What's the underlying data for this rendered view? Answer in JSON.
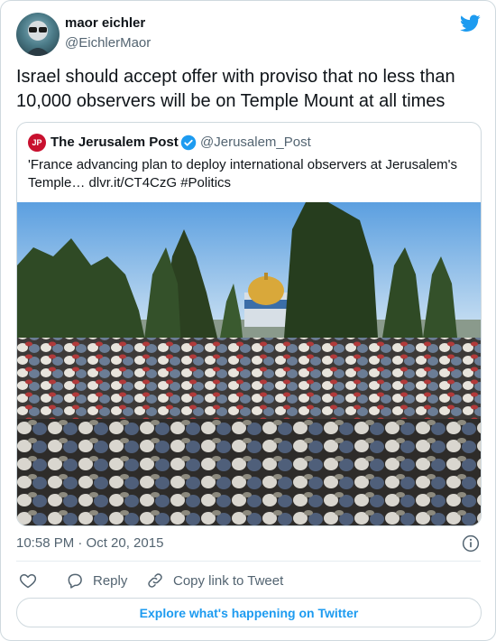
{
  "author": {
    "name": "maor eichler",
    "handle": "@EichlerMaor"
  },
  "tweet": {
    "text": "Israel should accept offer with proviso that no less than 10,000 observers will be on Temple Mount at all times"
  },
  "quoted": {
    "avatar_text": "JP",
    "name": "The Jerusalem Post",
    "handle": "@Jerusalem_Post",
    "text": "'France advancing plan to deploy international observers at Jerusalem's Temple… dlvr.it/CT4CzG #Politics"
  },
  "meta": {
    "timestamp": "10:58 PM · Oct 20, 2015"
  },
  "actions": {
    "reply": "Reply",
    "copy_link": "Copy link to Tweet"
  },
  "explore": {
    "label": "Explore what's happening on Twitter"
  },
  "colors": {
    "accent": "#1d9bf0",
    "muted": "#536471",
    "border": "#cfd9de"
  },
  "icons": [
    "twitter-bird-icon",
    "verified-badge-icon",
    "info-icon",
    "heart-icon",
    "reply-icon",
    "link-icon"
  ]
}
